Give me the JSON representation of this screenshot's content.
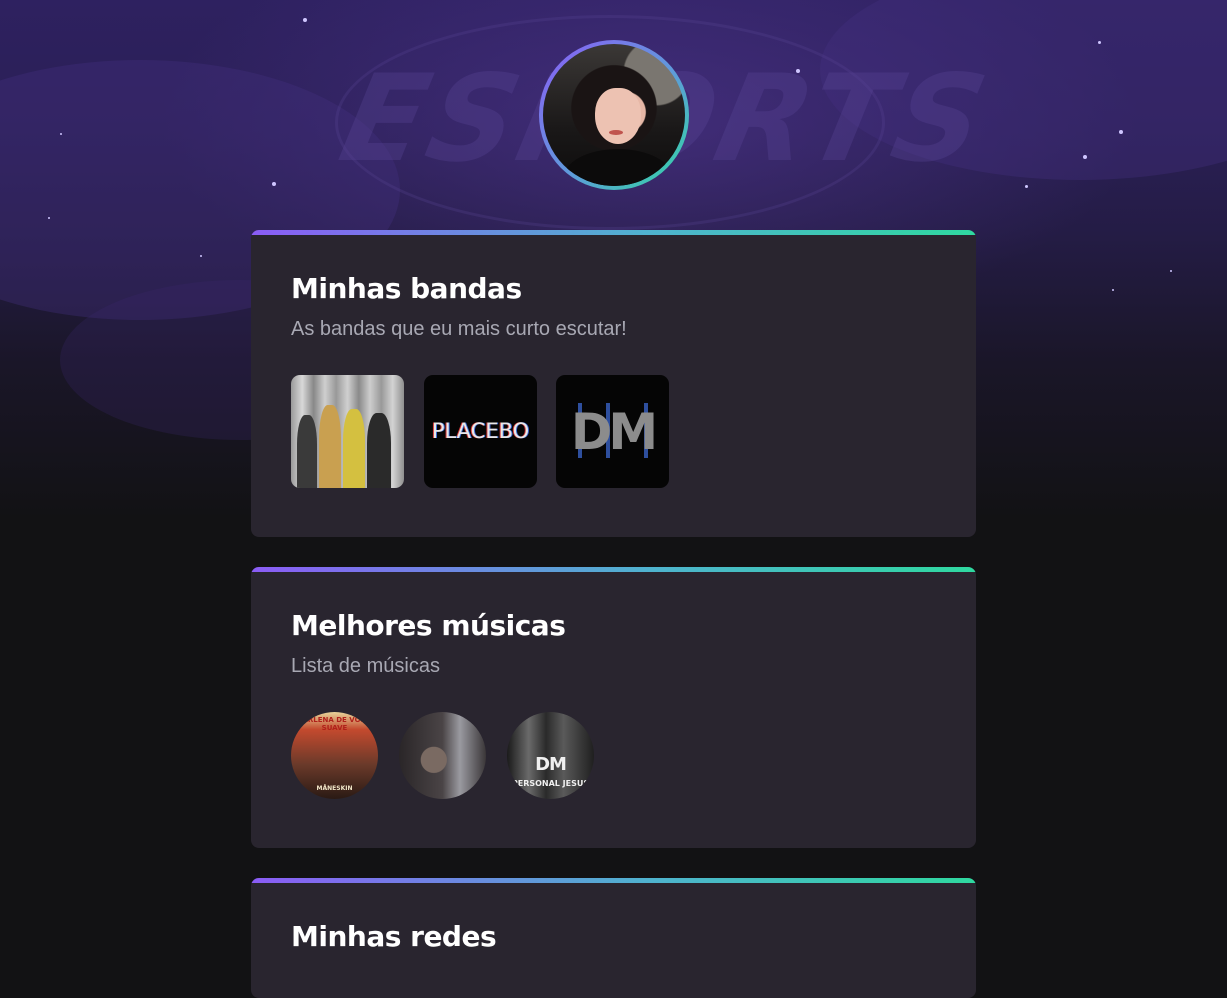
{
  "profile": {
    "background_logo_text": "ESPORTS",
    "avatar_alt": "profile photo"
  },
  "colors": {
    "background": "#121214",
    "card": "#29252f",
    "gradient_start": "#8b5cf6",
    "gradient_end": "#2fd9a0",
    "title": "#ffffff",
    "subtitle": "#a8a8b3"
  },
  "sections": [
    {
      "title": "Minhas bandas",
      "subtitle": "As bandas que eu mais curto escutar!",
      "items": [
        {
          "name": "maneskin-band-photo",
          "label": ""
        },
        {
          "name": "placebo-logo",
          "label": "PLACEBO"
        },
        {
          "name": "depeche-mode-logo",
          "label": "DM"
        }
      ]
    },
    {
      "title": "Melhores músicas",
      "subtitle": "Lista de músicas",
      "items": [
        {
          "name": "maneskin-song-cover",
          "label": "MARLENA DE VOLTA SUAVE",
          "caption": "MÅNESKIN"
        },
        {
          "name": "placebo-song-cover",
          "label": ""
        },
        {
          "name": "depeche-mode-song-cover",
          "label": "DM",
          "caption": "PERSONAL JESUS"
        }
      ]
    },
    {
      "title": "Minhas redes",
      "subtitle": ""
    }
  ]
}
